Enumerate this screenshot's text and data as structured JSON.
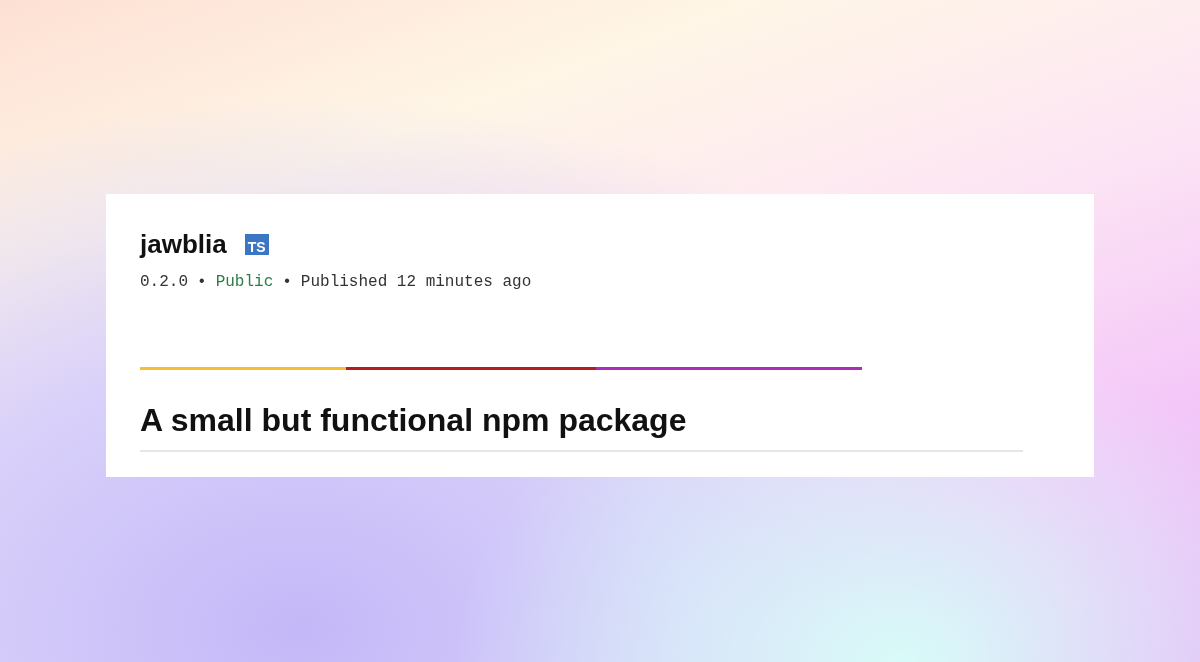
{
  "package": {
    "name": "jawblia",
    "types_badge": "TS"
  },
  "meta": [
    {
      "kind": "plain",
      "text": "0.2.0"
    },
    {
      "kind": "sep",
      "text": "•"
    },
    {
      "kind": "visibility",
      "text": "Public"
    },
    {
      "kind": "sep",
      "text": "•"
    },
    {
      "kind": "plain",
      "text": "Published 12 minutes ago"
    }
  ],
  "readme": {
    "heading": "A small but functional npm package"
  }
}
